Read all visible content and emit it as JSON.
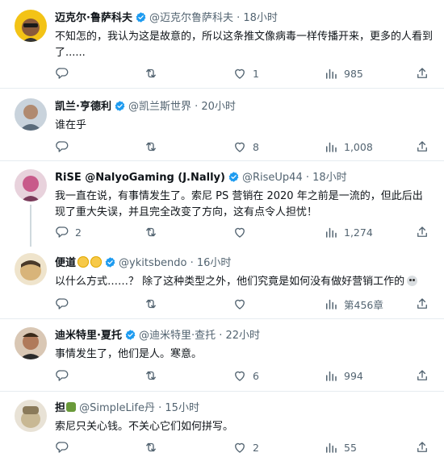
{
  "tweets": [
    {
      "name": "迈克尔·鲁萨科夫",
      "handle": "@迈克尔鲁萨科夫",
      "time": "18小时",
      "text": "不知怎的，我认为这是故意的，所以这条推文像病毒一样传播开来，更多的人看到了......",
      "replies": "",
      "retweets": "",
      "likes": "1",
      "views": "985"
    },
    {
      "name": "凯兰·亨德利",
      "handle": "@凯兰斯世界",
      "time": "20小时",
      "text": "谁在乎",
      "replies": "",
      "retweets": "",
      "likes": "8",
      "views": "1,008"
    },
    {
      "name": "RiSE @NalyoGaming (J.Nally)",
      "handle": "@RiseUp44",
      "time": "18小时",
      "text": "我一直在说，有事情发生了。索尼 PS 营销在 2020 年之前是一流的，但此后出现了重大失误，并且完全改变了方向，这有点令人担忧！",
      "replies": "2",
      "retweets": "",
      "likes": "",
      "views": "1,274"
    },
    {
      "name": "便道",
      "handle": "@ykitsbendo",
      "time": "16小时",
      "text": "以什么方式……？ 除了这种类型之外，他们究竟是如何没有做好营销工作的",
      "replies": "",
      "retweets": "",
      "likes": "",
      "views": "第456章"
    },
    {
      "name": "迪米特里·夏托",
      "handle": "@迪米特里·查托",
      "time": "22小时",
      "text": "事情发生了，他们是人。寒意。",
      "replies": "",
      "retweets": "",
      "likes": "6",
      "views": "994"
    },
    {
      "name": "担",
      "handle": "@SimpleLife丹",
      "time": "15小时",
      "text": "索尼只关心钱。不关心它们如何拼写。",
      "replies": "",
      "retweets": "",
      "likes": "2",
      "views": "55"
    }
  ],
  "sep": "·",
  "colors": {
    "verified": "#1d9bf0",
    "text": "#0f1419",
    "muted": "#536471"
  }
}
